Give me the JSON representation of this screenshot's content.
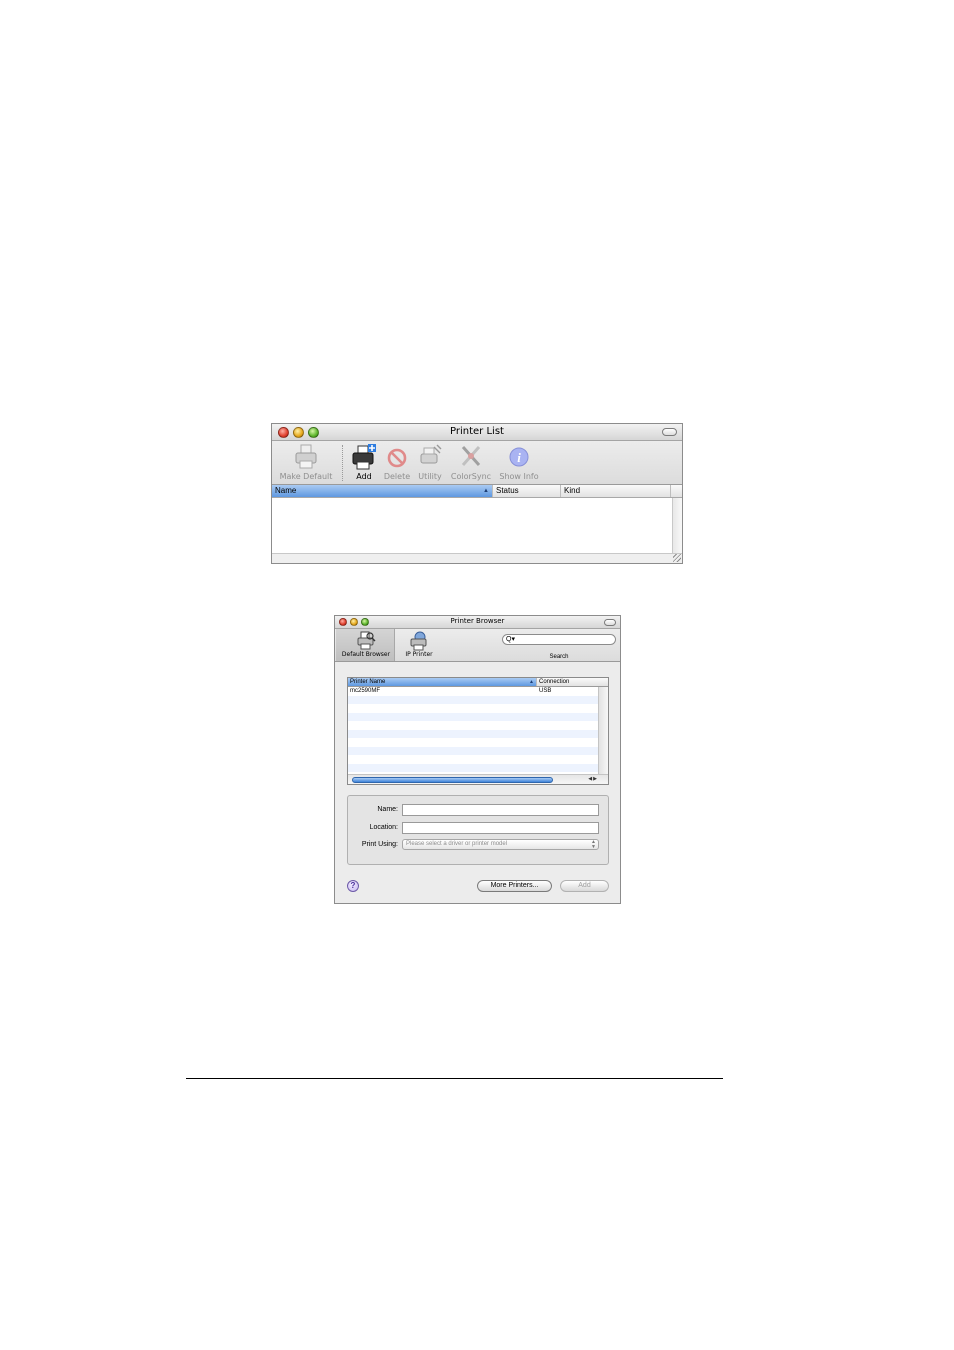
{
  "printer_list": {
    "title": "Printer List",
    "toolbar": {
      "make_default": "Make Default",
      "add": "Add",
      "delete": "Delete",
      "utility": "Utility",
      "colorsync": "ColorSync",
      "show_info": "Show Info"
    },
    "columns": {
      "name": "Name",
      "status": "Status",
      "kind": "Kind"
    }
  },
  "printer_browser": {
    "title": "Printer Browser",
    "toolbar": {
      "default_browser": "Default Browser",
      "ip_printer": "IP Printer",
      "search": "Search",
      "search_icon_glyph": "Q▾"
    },
    "columns": {
      "printer_name": "Printer Name",
      "connection": "Connection"
    },
    "rows": [
      {
        "name": "mc2590MF",
        "connection": "USB"
      }
    ],
    "form": {
      "name_label": "Name:",
      "name_value": "",
      "location_label": "Location:",
      "location_value": "",
      "print_using_label": "Print Using:",
      "print_using_value": "Please select a driver or printer model"
    },
    "buttons": {
      "help": "?",
      "more_printers": "More Printers...",
      "add": "Add"
    }
  },
  "colors": {
    "selected_column": "#5e98e0",
    "row_stripe": "#edf3fe",
    "scroll_thumb": "#3e83d8"
  }
}
